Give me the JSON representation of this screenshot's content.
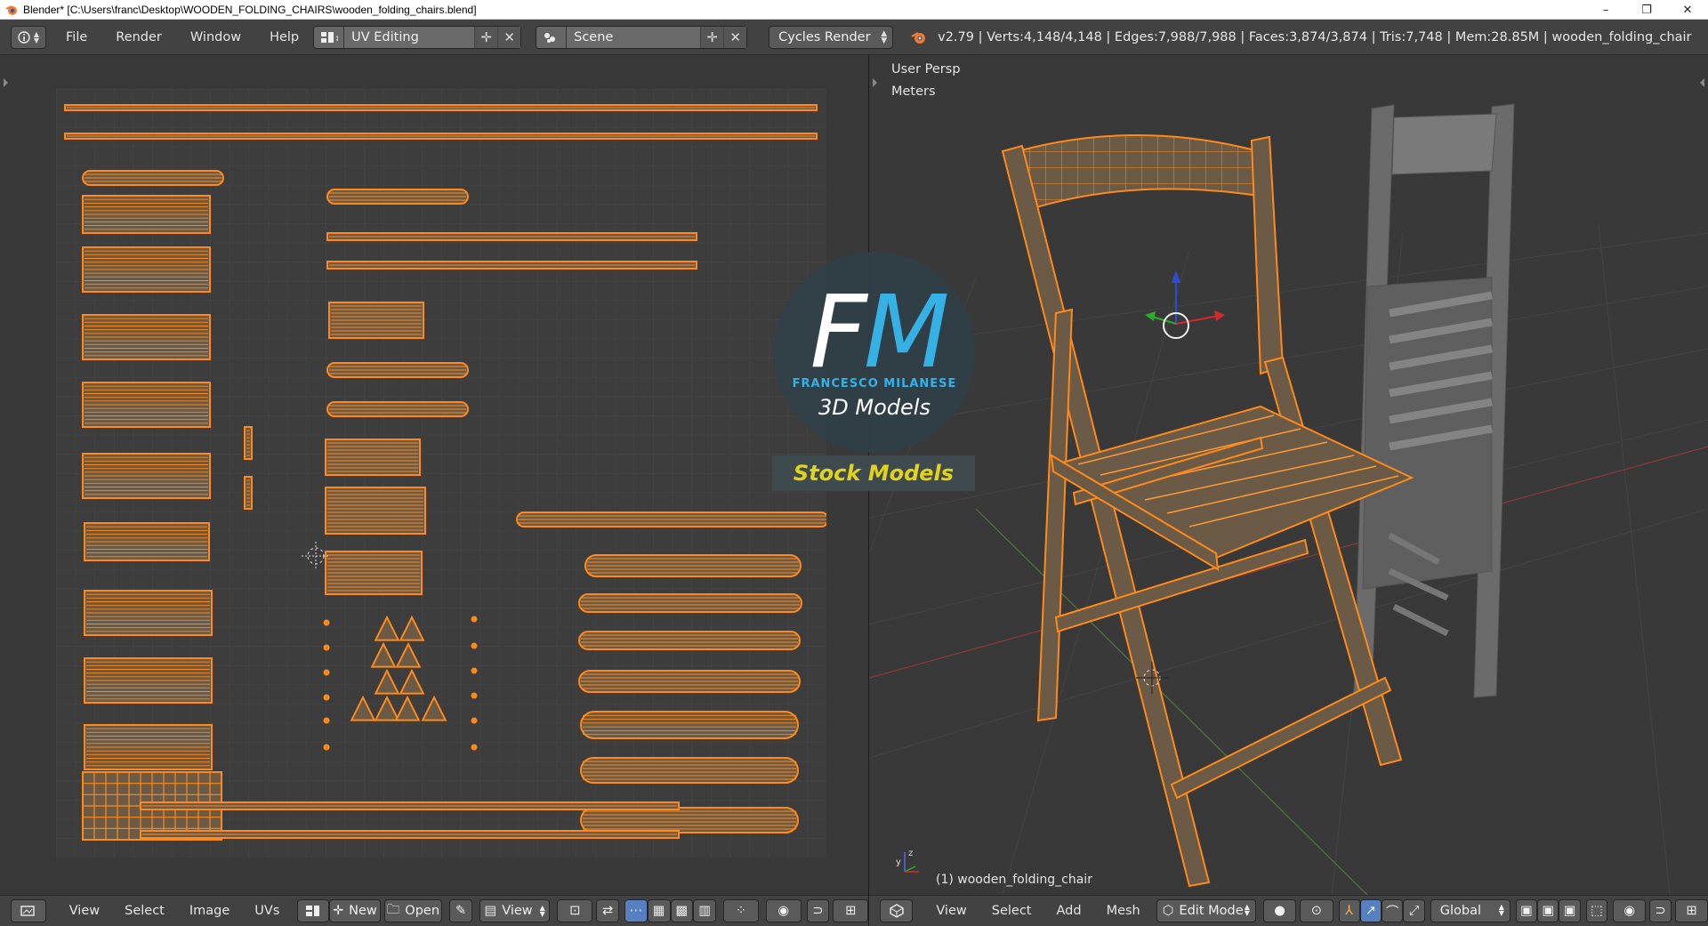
{
  "titlebar": {
    "title": "Blender* [C:\\Users\\franc\\Desktop\\WOODEN_FOLDING_CHAIRS\\wooden_folding_chairs.blend]",
    "minimize": "–",
    "maximize": "❐",
    "close": "✕"
  },
  "infobar": {
    "editor_icon": "info-icon",
    "menus": [
      "File",
      "Render",
      "Window",
      "Help"
    ],
    "screen_layout": "UV Editing",
    "scene": "Scene",
    "render_engine": "Cycles Render",
    "stats": "v2.79 | Verts:4,148/4,148 | Edges:7,988/7,988 | Faces:3,874/3,874 | Tris:7,748 | Mem:28.85M | wooden_folding_chair"
  },
  "viewport": {
    "view_name": "User Persp",
    "units": "Meters",
    "object_label": "(1) wooden_folding_chair"
  },
  "watermark": {
    "f": "F",
    "m": "M",
    "name": "FRANCESCO MILANESE",
    "subtitle": "3D Models",
    "badge": "Stock Models"
  },
  "uv_bottom": {
    "menus": [
      "View",
      "Select",
      "Image",
      "UVs"
    ],
    "new_label": "New",
    "open_label": "Open",
    "view_label": "View"
  },
  "v3d_bottom": {
    "menus": [
      "View",
      "Select",
      "Add",
      "Mesh"
    ],
    "mode": "Edit Mode",
    "orientation": "Global"
  },
  "colors": {
    "accent_orange": "#ff8a1a",
    "uv_face": "#6b5a46",
    "background": "#393939",
    "header": "#424242",
    "watermark_blue": "#35b1e6",
    "watermark_yellow": "#e1d31a"
  }
}
